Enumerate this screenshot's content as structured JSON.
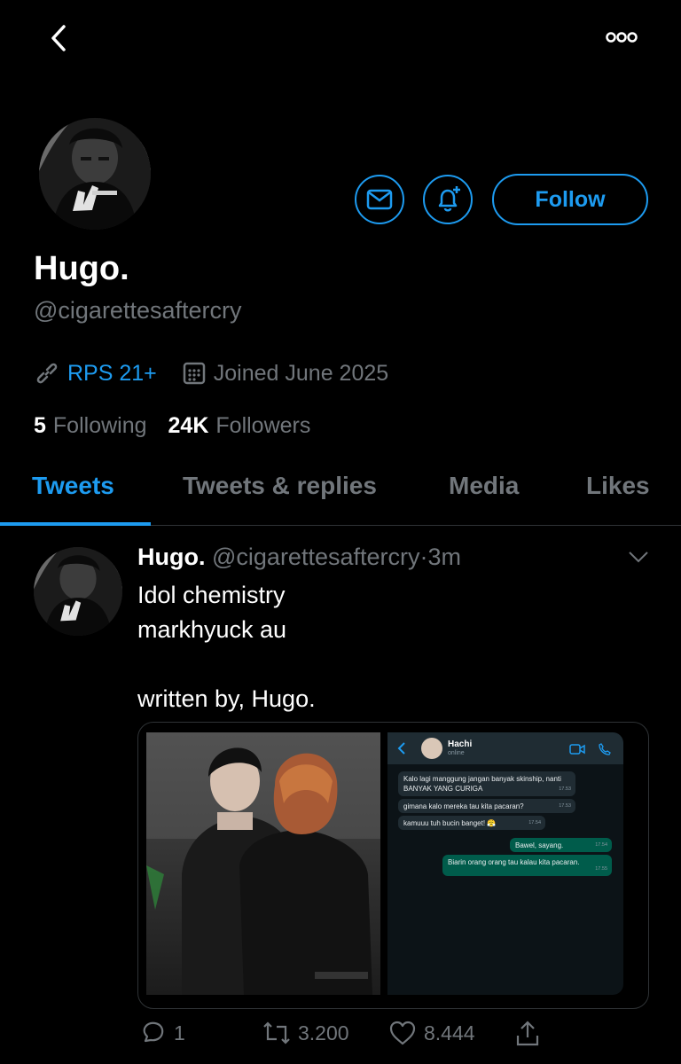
{
  "profile": {
    "name": "Hugo.",
    "handle": "@cigarettesaftercry",
    "website": "RPS 21+",
    "joined": "Joined June 2025",
    "following_count": "5",
    "following_label": "Following",
    "followers_count": "24K",
    "followers_label": "Followers",
    "follow_label": "Follow"
  },
  "tabs": [
    {
      "label": "Tweets",
      "active": true
    },
    {
      "label": "Tweets & replies"
    },
    {
      "label": "Media"
    },
    {
      "label": "Likes"
    }
  ],
  "tweet": {
    "name": "Hugo.",
    "handle": "@cigarettesaftercry",
    "separator": "·",
    "time": "3m",
    "lines": [
      "Idol chemistry",
      "markhyuck au",
      "",
      "written by, Hugo."
    ],
    "chat": {
      "contact": "Hachi",
      "status": "online",
      "messages": [
        {
          "text": "Kalo lagi manggung jangan banyak skinship, nanti BANYAK YANG CURIGA",
          "time": "17.53",
          "dir": "in"
        },
        {
          "text": "gimana kalo mereka tau kita pacaran?",
          "time": "17.53",
          "dir": "in"
        },
        {
          "text": "kamuuu tuh bucin banget! 😤",
          "time": "17.54",
          "dir": "in"
        },
        {
          "text": "Bawel, sayang.",
          "time": "17.54",
          "dir": "out"
        },
        {
          "text": "Biarin orang orang tau kalau kita pacaran.",
          "time": "17.55",
          "dir": "out"
        }
      ]
    },
    "replies": "1",
    "retweets": "3.200",
    "likes": "8.444"
  },
  "colors": {
    "accent": "#1d9bf0",
    "muted": "#71767b",
    "background": "#000000"
  }
}
